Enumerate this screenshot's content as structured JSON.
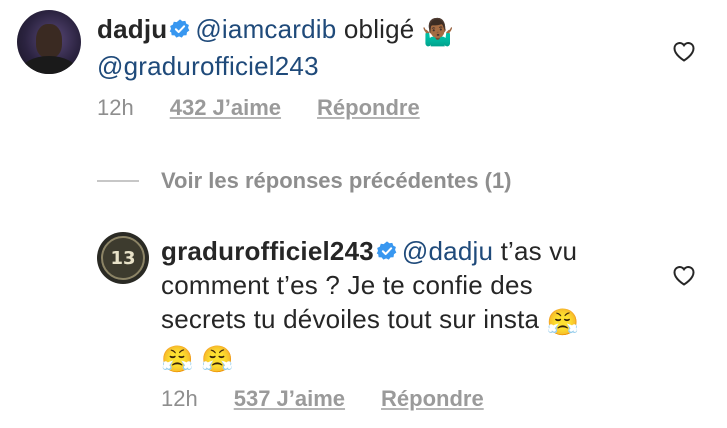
{
  "comments": [
    {
      "username": "dadju",
      "verified": true,
      "mention": "@iamcardib",
      "text_after_mention": " obligé",
      "emoji": "🤷🏾‍♂️",
      "second_mention": "@gradurofficiel243",
      "time": "12h",
      "likes": "432 J’aime",
      "reply_label": "Répondre",
      "avatar_icon": "user-avatar-photo"
    },
    {
      "username": "gradurofficiel243",
      "verified": true,
      "mention": "@dadju",
      "line1_rest": " t’as vu",
      "line2": "comment t’es ? Je te confie des",
      "line3": "secrets tu dévoiles tout sur insta",
      "emoji": "😤",
      "time": "12h",
      "likes": "537 J’aime",
      "reply_label": "Répondre",
      "avatar_icon": "13-logo",
      "avatar_text": "13"
    }
  ],
  "view_replies_label": "Voir les réponses précédentes (1)",
  "colors": {
    "text": "#262626",
    "mention": "#1f4a7a",
    "meta": "#8e8e8e",
    "verified": "#3897f0"
  }
}
